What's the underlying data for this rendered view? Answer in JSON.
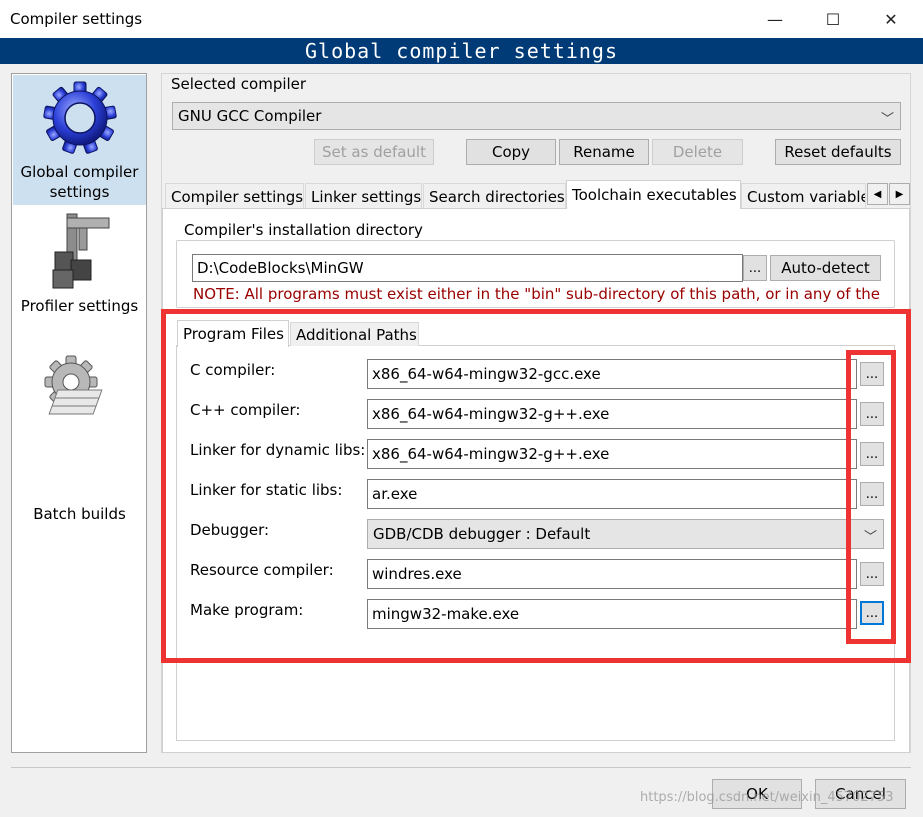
{
  "window": {
    "title": "Compiler settings",
    "banner": "Global compiler settings",
    "controls": {
      "minimize": "—",
      "maximize": "☐",
      "close": "✕"
    }
  },
  "nav": {
    "items": [
      {
        "label_line1": "Global compiler",
        "label_line2": "settings",
        "icon": "gear-icon"
      },
      {
        "label": "Profiler settings",
        "icon": "caliper-icon"
      },
      {
        "label": "Batch builds",
        "icon": "batch-gear-icon"
      }
    ]
  },
  "selected_compiler": {
    "label": "Selected compiler",
    "value": "GNU GCC Compiler",
    "buttons": {
      "set_default": "Set as default",
      "copy": "Copy",
      "rename": "Rename",
      "delete": "Delete",
      "reset": "Reset defaults"
    }
  },
  "tabs": {
    "items": [
      "Compiler settings",
      "Linker settings",
      "Search directories",
      "Toolchain executables",
      "Custom variable"
    ],
    "active": "Toolchain executables",
    "scroll_left": "◀",
    "scroll_right": "▶"
  },
  "install_dir": {
    "label": "Compiler's installation directory",
    "value": "D:\\CodeBlocks\\MinGW",
    "browse": "...",
    "autodetect": "Auto-detect",
    "note": "NOTE: All programs must exist either in the \"bin\" sub-directory of this path, or in any of the"
  },
  "subtabs": {
    "items": [
      "Program Files",
      "Additional Paths"
    ],
    "active": "Program Files"
  },
  "programs": {
    "rows": [
      {
        "label": "C compiler:",
        "value": "x86_64-w64-mingw32-gcc.exe",
        "browse": "..."
      },
      {
        "label": "C++ compiler:",
        "value": "x86_64-w64-mingw32-g++.exe",
        "browse": "..."
      },
      {
        "label": "Linker for dynamic libs:",
        "value": "x86_64-w64-mingw32-g++.exe",
        "browse": "..."
      },
      {
        "label": "Linker for static libs:",
        "value": "ar.exe",
        "browse": "..."
      },
      {
        "label": "Debugger:",
        "value": "GDB/CDB debugger : Default"
      },
      {
        "label": "Resource compiler:",
        "value": "windres.exe",
        "browse": "..."
      },
      {
        "label": "Make program:",
        "value": "mingw32-make.exe",
        "browse": "..."
      }
    ]
  },
  "footer": {
    "ok": "OK",
    "cancel": "Cancel"
  },
  "watermark": "https://blog.csdn.net/weixin_45702753",
  "colors": {
    "banner_bg": "#003b78",
    "highlight_red": "#ee3333",
    "note_text": "#990000",
    "nav_selected": "#cde0f0"
  }
}
